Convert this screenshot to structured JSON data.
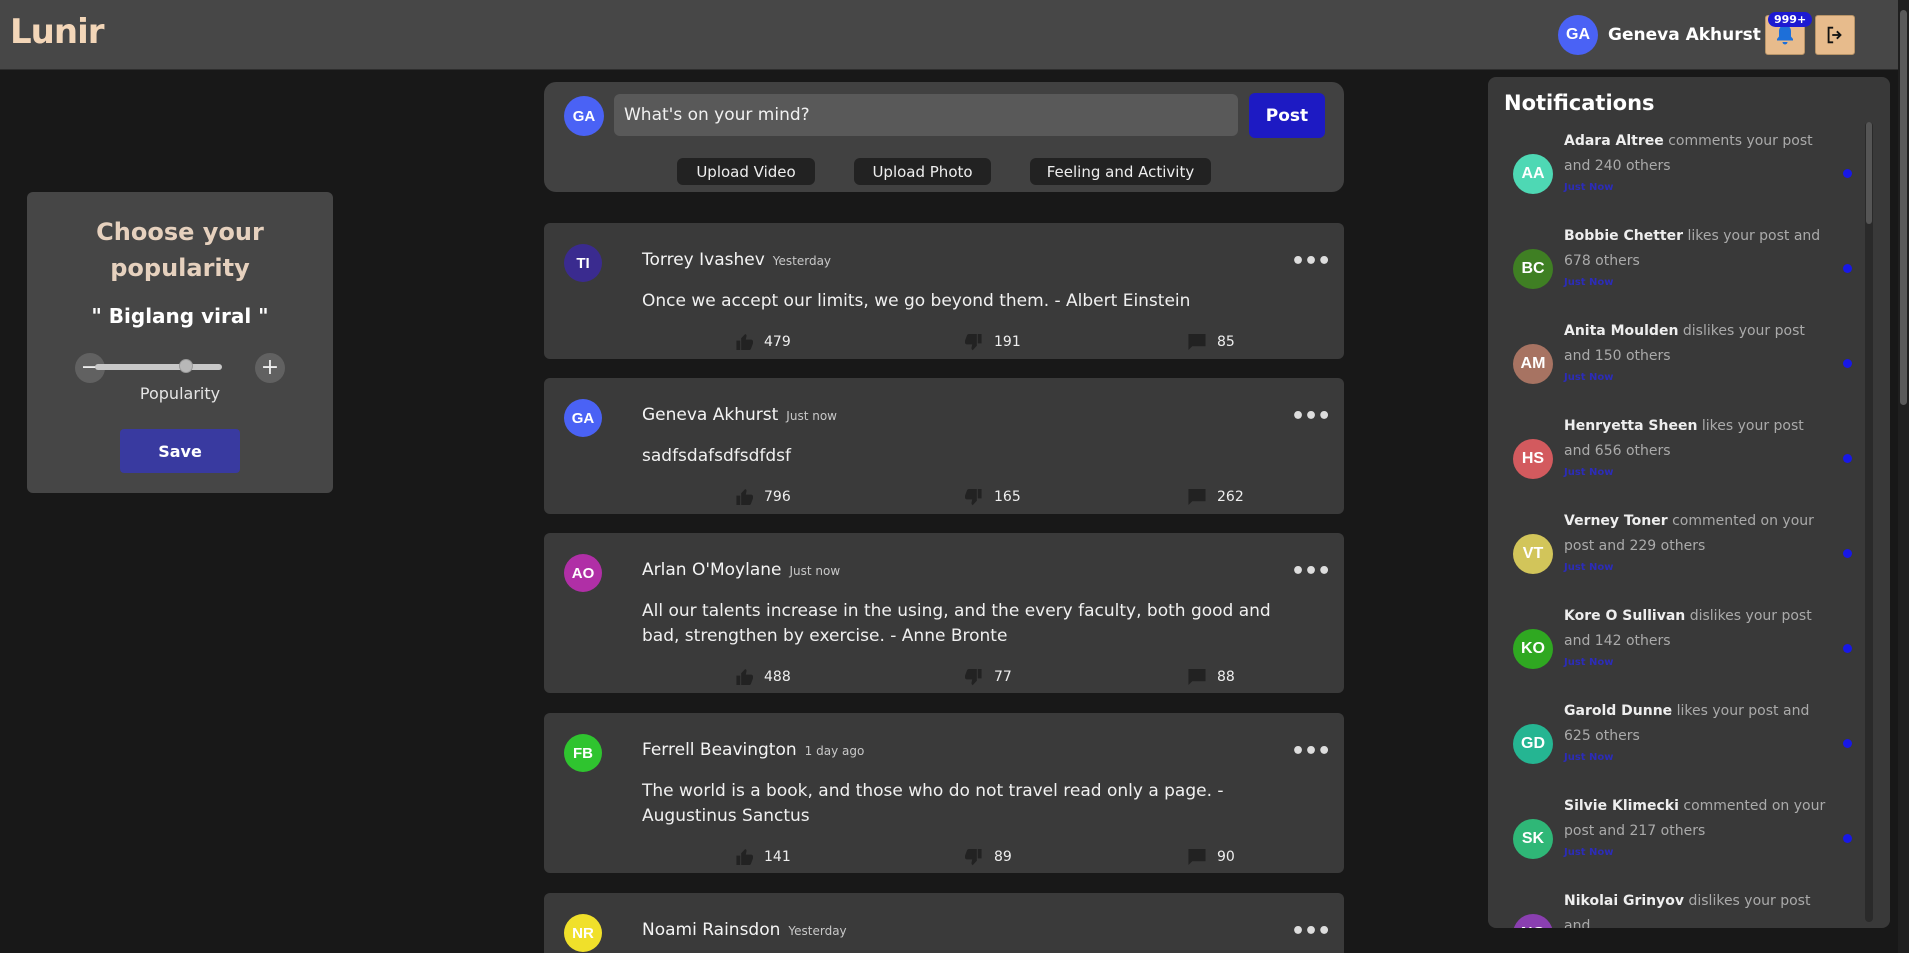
{
  "app": {
    "logo": "Lunir"
  },
  "header": {
    "user": {
      "initials": "GA",
      "name": "Geneva Akhurst",
      "avatar_color": "#4a62f5"
    },
    "notification_badge": "999+",
    "bell_icon": "bell-icon",
    "logout_icon": "logout-icon"
  },
  "popularity": {
    "title": "Choose your popularity",
    "value": "\" Biglang viral \"",
    "slider_label": "Popularity",
    "slider_level": 0.72,
    "minus": "−",
    "plus": "+",
    "save_label": "Save"
  },
  "composer": {
    "initials": "GA",
    "avatar_color": "#4a62f5",
    "placeholder": "What's on your mind?",
    "post_label": "Post",
    "actions": [
      "Upload Video",
      "Upload Photo",
      "Feeling and Activity"
    ]
  },
  "posts": [
    {
      "initials": "TI",
      "avatar_color": "#3a2b8f",
      "name": "Torrey Ivashev",
      "time": "Yesterday",
      "text": "Once we accept our limits, we go beyond them. - Albert Einstein",
      "likes": "479",
      "dislikes": "191",
      "comments": "85"
    },
    {
      "initials": "GA",
      "avatar_color": "#4a62f5",
      "name": "Geneva Akhurst",
      "time": "Just now",
      "text": "sadfsdafsdfsdfdsf",
      "likes": "796",
      "dislikes": "165",
      "comments": "262"
    },
    {
      "initials": "AO",
      "avatar_color": "#b02fa6",
      "name": "Arlan O'Moylane",
      "time": "Just now",
      "text": "All our talents increase in the using, and the every faculty, both good and bad, strengthen by exercise. - Anne Bronte",
      "likes": "488",
      "dislikes": "77",
      "comments": "88"
    },
    {
      "initials": "FB",
      "avatar_color": "#2fc42f",
      "name": "Ferrell Beavington",
      "time": "1 day ago",
      "text": "The world is a book, and those who do not travel read only a page. - Augustinus Sanctus",
      "likes": "141",
      "dislikes": "89",
      "comments": "90"
    },
    {
      "initials": "NR",
      "avatar_color": "#f0e02a",
      "name": "Noami Rainsdon",
      "time": "Yesterday",
      "text": "",
      "likes": "",
      "dislikes": "",
      "comments": ""
    }
  ],
  "notifications": {
    "title": "Notifications",
    "items": [
      {
        "initials": "AA",
        "avatar_color": "#4ed8b4",
        "name": "Adara Altree",
        "action": "comments your post and 240 others",
        "time": "Just Now"
      },
      {
        "initials": "BC",
        "avatar_color": "#3f7f23",
        "name": "Bobbie Chetter",
        "action": "likes your post and 678 others",
        "time": "Just Now"
      },
      {
        "initials": "AM",
        "avatar_color": "#a77362",
        "name": "Anita Moulden",
        "action": "dislikes your post and 150 others",
        "time": "Just Now"
      },
      {
        "initials": "HS",
        "avatar_color": "#d35a5e",
        "name": "Henryetta Sheen",
        "action": "likes your post and 656 others",
        "time": "Just Now"
      },
      {
        "initials": "VT",
        "avatar_color": "#d2c55a",
        "name": "Verney Toner",
        "action": "commented on your post and 229 others",
        "time": "Just Now"
      },
      {
        "initials": "KO",
        "avatar_color": "#2fa821",
        "name": "Kore O Sullivan",
        "action": "dislikes your post and 142 others",
        "time": "Just Now"
      },
      {
        "initials": "GD",
        "avatar_color": "#25b592",
        "name": "Garold Dunne",
        "action": "likes your post and 625 others",
        "time": "Just Now"
      },
      {
        "initials": "SK",
        "avatar_color": "#2fb777",
        "name": "Silvie Klimecki",
        "action": "commented on your post and 217 others",
        "time": "Just Now"
      },
      {
        "initials": "NG",
        "avatar_color": "#8a3fb0",
        "name": "Nikolai Grinyov",
        "action": "dislikes your post and",
        "time": ""
      }
    ]
  }
}
